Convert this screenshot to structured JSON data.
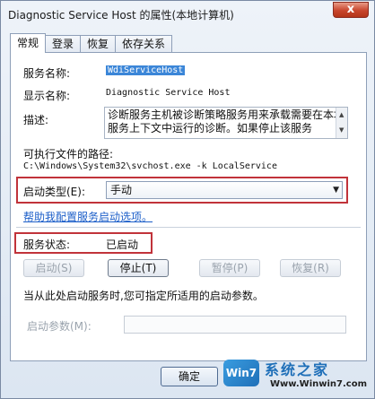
{
  "window": {
    "title": "Diagnostic Service Host 的属性(本地计算机)",
    "close_glyph": "x"
  },
  "tabs": [
    "常规",
    "登录",
    "恢复",
    "依存关系"
  ],
  "general": {
    "service_name_label": "服务名称:",
    "service_name_value": "WdiServiceHost",
    "display_name_label": "显示名称:",
    "display_name_value": "Diagnostic Service Host",
    "description_label": "描述:",
    "description_value": "诊断服务主机被诊断策略服务用来承载需要在本地服务上下文中运行的诊断。如果停止该服务",
    "exe_path_label": "可执行文件的路径:",
    "exe_path_value": "C:\\Windows\\System32\\svchost.exe -k LocalService",
    "startup_type_label": "启动类型(E):",
    "startup_type_value": "手动",
    "help_link": "帮助我配置服务启动选项。",
    "status_label": "服务状态:",
    "status_value": "已启动",
    "buttons": {
      "start": "启动(S)",
      "stop": "停止(T)",
      "pause": "暂停(P)",
      "resume": "恢复(R)"
    },
    "hint": "当从此处启动服务时,您可指定所适用的启动参数。",
    "params_label": "启动参数(M):",
    "params_value": ""
  },
  "footer": {
    "ok": "确定"
  },
  "watermark": {
    "badge": "Win7",
    "title": "系统之家",
    "url": "Www.Winwin7.com"
  },
  "colors": {
    "highlight_box": "#c1333a",
    "link": "#1d5fc9",
    "selection": "#3b86d8"
  }
}
